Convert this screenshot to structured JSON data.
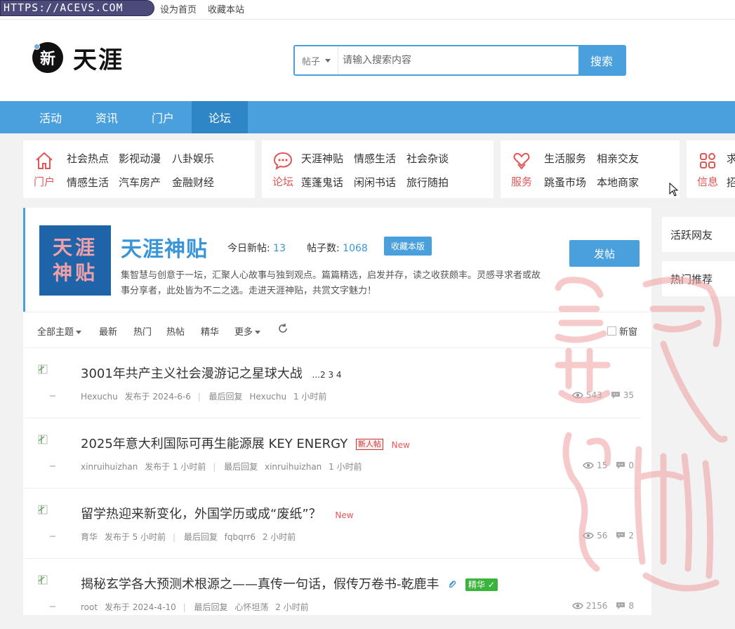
{
  "topbar": {
    "url": "HTTPS://ACEVS.COM",
    "set_home": "设为首页",
    "bookmark": "收藏本站"
  },
  "header": {
    "logo_icon_char": "新",
    "logo_text": "天涯",
    "search": {
      "type": "帖子",
      "placeholder": "请输入搜索内容",
      "button": "搜索"
    }
  },
  "nav": {
    "items": [
      "活动",
      "资讯",
      "门户",
      "论坛"
    ],
    "active": "论坛"
  },
  "categories": [
    {
      "name": "门户",
      "icon": "home-icon",
      "links": [
        "社会热点",
        "影视动漫",
        "八卦娱乐",
        "情感生活",
        "汽车房产",
        "金融财经"
      ]
    },
    {
      "name": "论坛",
      "icon": "chat-icon",
      "links": [
        "天涯神贴",
        "情感生活",
        "社会杂谈",
        "莲蓬鬼话",
        "闲闲书话",
        "旅行随拍"
      ]
    },
    {
      "name": "服务",
      "icon": "heart-hand-icon",
      "links": [
        "生活服务",
        "相亲交友",
        "跳蚤市场",
        "本地商家"
      ]
    },
    {
      "name": "信息",
      "icon": "grid-icon",
      "links": [
        "求",
        "招"
      ]
    }
  ],
  "forum": {
    "logo_text": [
      "天涯",
      "神贴"
    ],
    "title": "天涯神贴",
    "today_label": "今日新帖:",
    "today_value": "13",
    "posts_label": "帖子数:",
    "posts_value": "1068",
    "fav_button": "收藏本版",
    "post_button": "发帖",
    "description": "集智慧与创意于一坛，汇聚人心故事与独到观点。篇篇精选，启发并存，读之收获颇丰。灵感寻求者或故事分享者，此处皆为不二之选。走进天涯神贴，共赏文字魅力！"
  },
  "filters": {
    "all": "全部主题",
    "latest": "最新",
    "hot": "热门",
    "hot_posts": "热帖",
    "featured": "精华",
    "more": "更多",
    "new_window": "新窗"
  },
  "threads": [
    {
      "title": "3001年共产主义社会漫游记之星球大战",
      "pages": "...2 3 4",
      "author": "Hexuchu",
      "posted": "发布于 2024-6-6",
      "last_label": "最后回复",
      "last_user": "Hexuchu",
      "last_time": "1 小时前",
      "views": "543",
      "replies": "35"
    },
    {
      "title": "2025年意大利国际可再生能源展 KEY ENERGY",
      "tag_new_user": "新人帖",
      "new": "New",
      "author": "xinruihuizhan",
      "posted": "发布于 1 小时前",
      "last_label": "最后回复",
      "last_user": "xinruihuizhan",
      "last_time": "1 小时前",
      "views": "15",
      "replies": "0"
    },
    {
      "title": "留学热迎来新变化，外国学历或成“废纸”？",
      "new": "New",
      "author": "育华",
      "posted": "发布于 5 小时前",
      "last_label": "最后回复",
      "last_user": "fqbqrr6",
      "last_time": "2 小时前",
      "views": "56",
      "replies": "2"
    },
    {
      "title": "揭秘玄学各大预测术根源之——真传一句话，假传万卷书-乾鹿丰",
      "tag_best": "精华",
      "author": "root",
      "posted": "发布于 2024-4-10",
      "last_label": "最后回复",
      "last_user": "心怀坦荡",
      "last_time": "2 小时前",
      "views": "2156",
      "replies": "8"
    }
  ],
  "sidebar": {
    "active_friends": "活跃网友",
    "hot_recommend": "热门推荐"
  },
  "colors": {
    "primary": "#4aa0dc",
    "primary_dark": "#2f86c6",
    "accent_red": "#e25555",
    "badge_green": "#3cb33c"
  }
}
